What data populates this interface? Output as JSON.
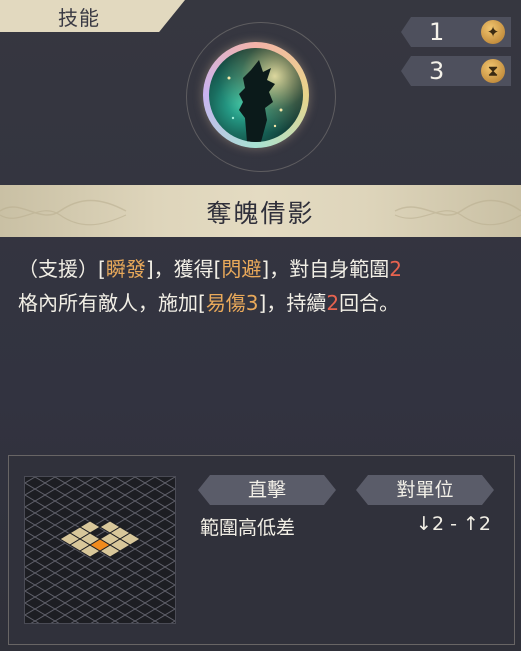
{
  "tab": {
    "label": "技能"
  },
  "costs": [
    {
      "value": "1",
      "icon": "star-coin-icon"
    },
    {
      "value": "3",
      "icon": "hourglass-icon"
    }
  ],
  "portrait": {
    "icon": "silhouette-portrait"
  },
  "skill": {
    "name": "奪魄倩影"
  },
  "description": {
    "line1": [
      "（支援）[",
      "瞬發",
      "]，獲得[",
      "閃避",
      "]，對自身範圍",
      "2"
    ],
    "line2": [
      "格內所有敵人，施加[",
      "易傷3",
      "]，持續",
      "2",
      "回合。"
    ]
  },
  "details": {
    "attack_type": "直擊",
    "target_type": "對單位",
    "range_label": "範圍高低差",
    "range_value": "↓2 - ↑2"
  },
  "colors": {
    "keyword": "#e9a95a",
    "number": "#e8634f",
    "banner": "#e2d9bf"
  }
}
